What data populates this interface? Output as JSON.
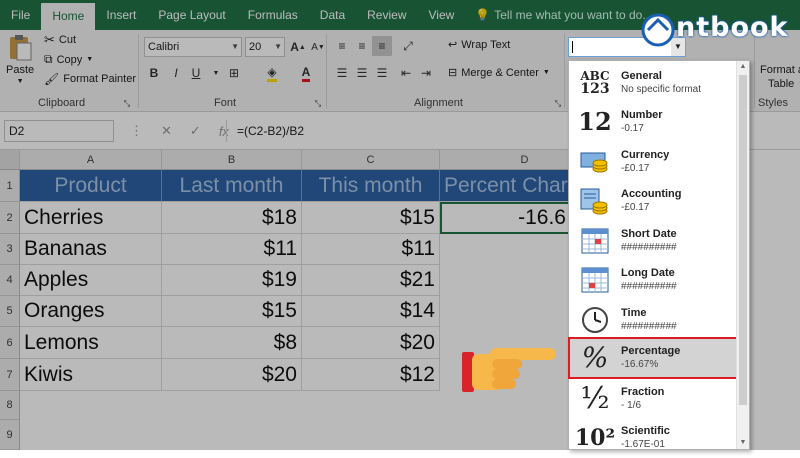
{
  "tabs": [
    "File",
    "Home",
    "Insert",
    "Page Layout",
    "Formulas",
    "Data",
    "Review",
    "View"
  ],
  "tell_me": "Tell me what you want to do...",
  "logo_text": "ntbook",
  "clipboard": {
    "paste": "Paste",
    "cut": "Cut",
    "copy": "Copy",
    "format_painter": "Format Painter",
    "label": "Clipboard"
  },
  "font": {
    "name": "Calibri",
    "size": "20",
    "bold": "B",
    "italic": "I",
    "underline": "U",
    "label": "Font"
  },
  "alignment": {
    "wrap_text": "Wrap Text",
    "merge_center": "Merge & Center",
    "label": "Alignment"
  },
  "styles": {
    "format_as": "Format a",
    "table": "Table",
    "label": "Styles"
  },
  "formula_bar": {
    "name_box": "D2",
    "formula": "=(C2-B2)/B2",
    "fx": "fx"
  },
  "columns": [
    "A",
    "B",
    "C",
    "D"
  ],
  "rows": [
    "1",
    "2",
    "3",
    "4",
    "5",
    "6",
    "7",
    "8",
    "9"
  ],
  "table": {
    "headers": [
      "Product",
      "Last month",
      "This month",
      "Percent Char"
    ],
    "rows": [
      [
        "Cherries",
        "$18",
        "$15",
        "-16.6"
      ],
      [
        "Bananas",
        "$11",
        "$11",
        ""
      ],
      [
        "Apples",
        "$19",
        "$21",
        ""
      ],
      [
        "Oranges",
        "$15",
        "$14",
        ""
      ],
      [
        "Lemons",
        "$8",
        "$20",
        ""
      ],
      [
        "Kiwis",
        "$20",
        "$12",
        ""
      ]
    ]
  },
  "number_format_menu": [
    {
      "title": "General",
      "sample": "No specific format",
      "icon": "general-icon",
      "glyph": "ABC\n123"
    },
    {
      "title": "Number",
      "sample": "-0.17",
      "icon": "number-icon",
      "glyph": "12"
    },
    {
      "title": "Currency",
      "sample": "-£0.17",
      "icon": "currency-icon",
      "glyph": ""
    },
    {
      "title": "Accounting",
      "sample": "-£0.17",
      "icon": "accounting-icon",
      "glyph": ""
    },
    {
      "title": "Short Date",
      "sample": "##########",
      "icon": "calendar-icon",
      "glyph": ""
    },
    {
      "title": "Long Date",
      "sample": "##########",
      "icon": "calendar-icon",
      "glyph": ""
    },
    {
      "title": "Time",
      "sample": "##########",
      "icon": "clock-icon",
      "glyph": ""
    },
    {
      "title": "Percentage",
      "sample": "-16.67%",
      "icon": "percent-icon",
      "glyph": "%"
    },
    {
      "title": "Fraction",
      "sample": "- 1/6",
      "icon": "fraction-icon",
      "glyph": "½"
    },
    {
      "title": "Scientific",
      "sample": "-1.67E-01",
      "icon": "scientific-icon",
      "glyph": "10²"
    }
  ],
  "colors": {
    "excel_green": "#217346",
    "header_blue": "#2e62a6",
    "highlight_red": "#e01a22"
  }
}
